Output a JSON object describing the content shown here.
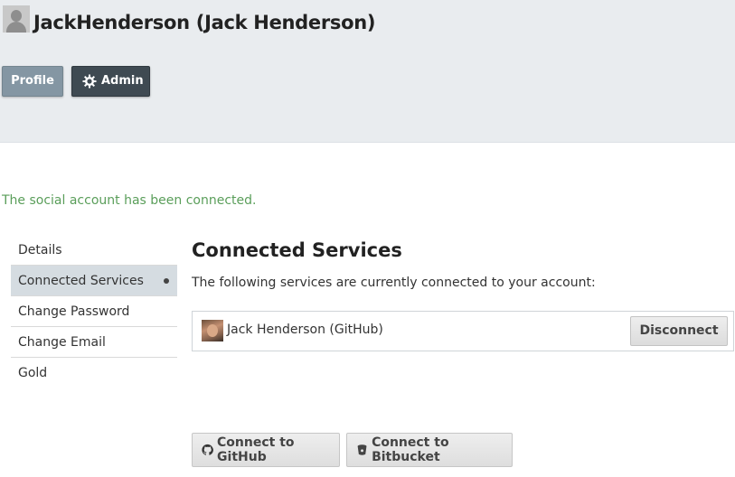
{
  "header": {
    "user_title": "JackHenderson (Jack Henderson)",
    "buttons": {
      "profile": "Profile",
      "admin": "Admin"
    }
  },
  "flash_message": "The social account has been connected.",
  "sidebar": {
    "items": [
      {
        "label": "Details",
        "active": false
      },
      {
        "label": "Connected Services",
        "active": true
      },
      {
        "label": "Change Password",
        "active": false
      },
      {
        "label": "Change Email",
        "active": false
      },
      {
        "label": "Gold",
        "active": false
      }
    ]
  },
  "main": {
    "title": "Connected Services",
    "description": "The following services are currently connected to your account:",
    "services": [
      {
        "label": "Jack Henderson (GitHub)",
        "action": "Disconnect"
      }
    ],
    "connect_buttons": {
      "github": "Connect to GitHub",
      "bitbucket": "Connect to Bitbucket"
    }
  },
  "colors": {
    "header_bg": "#e9ecef",
    "profile_button": "#8496a3",
    "admin_button": "#3f4a52",
    "flash_text": "#5a9e5a",
    "active_sidebar_bg": "#d5dce1"
  },
  "icons": [
    "user-placeholder-icon",
    "gear-icon",
    "github-icon",
    "bitbucket-icon"
  ]
}
